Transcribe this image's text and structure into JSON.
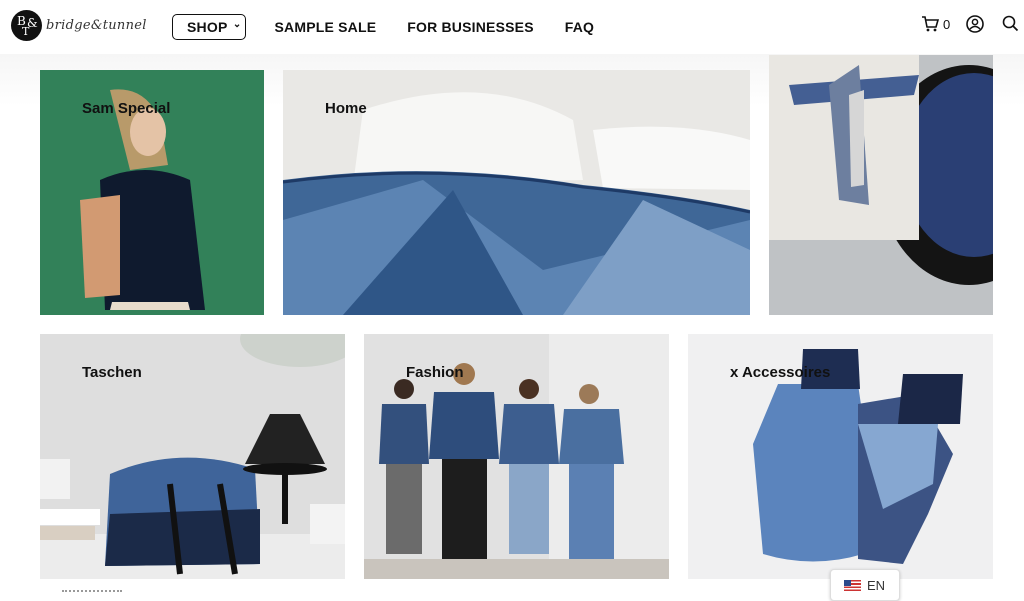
{
  "header": {
    "logo_text": "bridge&tunnel",
    "logo_letters": [
      "B",
      "T",
      "&"
    ],
    "nav": [
      {
        "label": "SHOP"
      },
      {
        "label": "SAMPLE SALE"
      },
      {
        "label": "FOR BUSINESSES"
      },
      {
        "label": "FAQ"
      }
    ],
    "cart_count": "0",
    "icons": [
      "cart-icon",
      "account-icon",
      "search-icon"
    ]
  },
  "tiles": [
    {
      "label": "Sam Special"
    },
    {
      "label": "Home"
    },
    {
      "label": ""
    },
    {
      "label": "Taschen"
    },
    {
      "label": "Fashion"
    },
    {
      "label": "x Accessoires"
    }
  ],
  "language": {
    "code": "EN",
    "flag": "us-flag-icon"
  },
  "colors": {
    "brand": "#111111",
    "denim": "#4a6fa0"
  }
}
